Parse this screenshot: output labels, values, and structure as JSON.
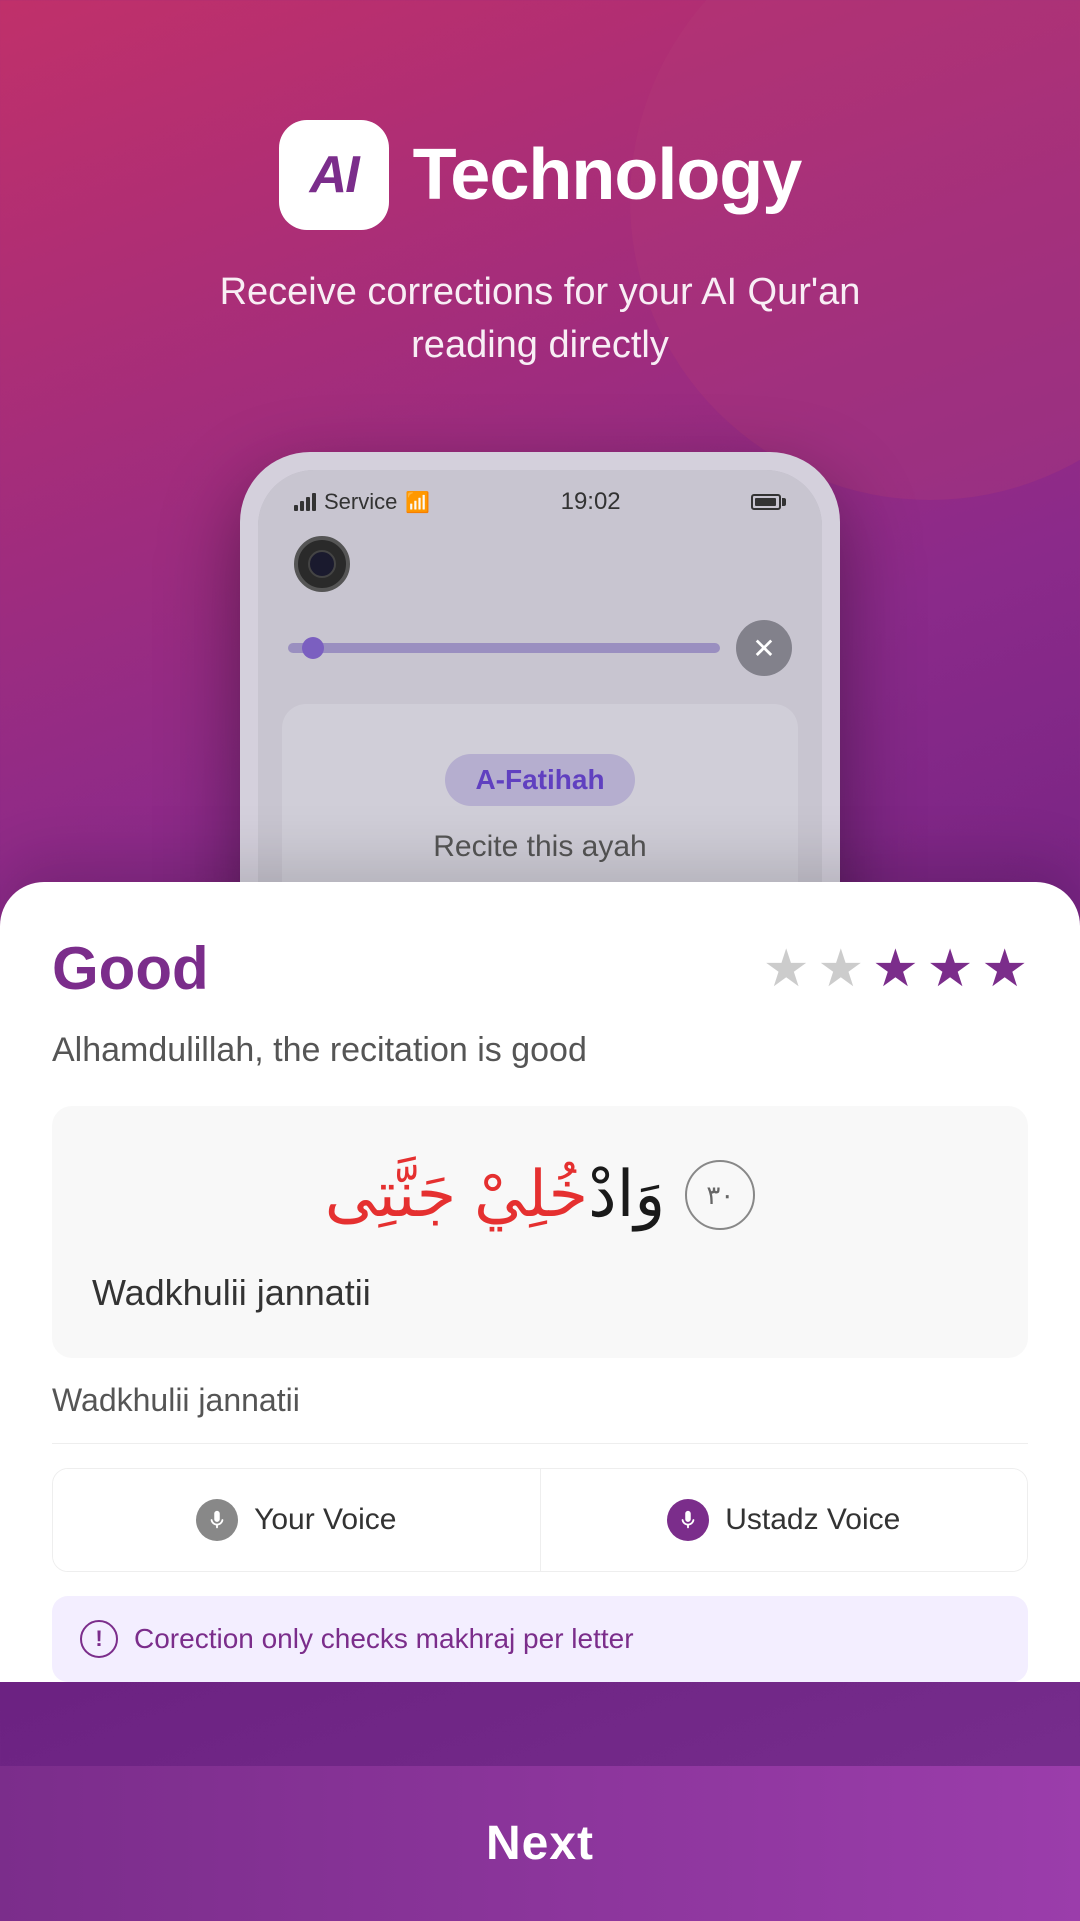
{
  "header": {
    "ai_badge": "AI",
    "tech_label": "Technology",
    "subtitle": "Receive corrections for your AI Qur'an reading directly"
  },
  "phone": {
    "status_bar": {
      "service": "Service",
      "time": "19:02"
    },
    "surah_name": "A-Fatihah",
    "recite_prompt": "Recite this ayah"
  },
  "rating_card": {
    "grade": "Good",
    "stars": [
      {
        "filled": false
      },
      {
        "filled": false
      },
      {
        "filled": true
      },
      {
        "filled": true
      },
      {
        "filled": true
      }
    ],
    "description": "Alhamdulillah, the recitation is good",
    "arabic_text": "وَادْخُلِيْ جَنَّتِى",
    "ayah_number": "٣٠",
    "transliteration": "Wadkhulii jannatii"
  },
  "lower": {
    "transliteration": "Wadkhulii jannatii",
    "your_voice_label": "Your Voice",
    "ustadz_voice_label": "Ustadz Voice",
    "correction_notice": "Corection only checks makhraj per letter"
  },
  "next_button": {
    "label": "Next"
  }
}
